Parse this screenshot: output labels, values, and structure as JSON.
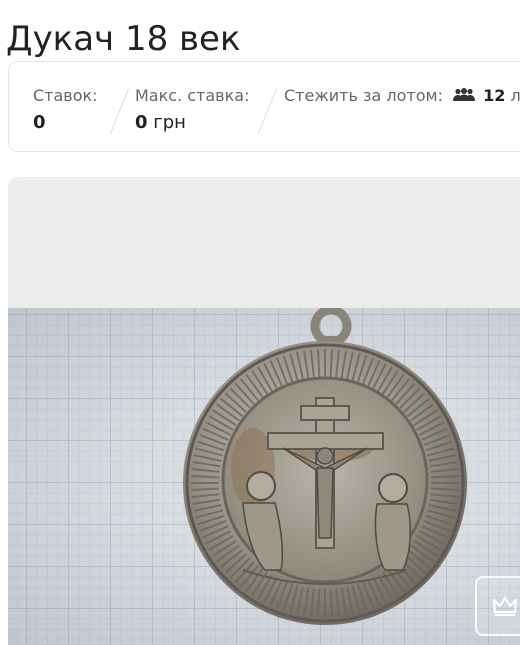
{
  "lot": {
    "title": "Дукач 18 век"
  },
  "stats": {
    "bids_label": "Ставок:",
    "bids_value": "0",
    "max_bid_label": "Макс. ставка:",
    "max_bid_amount": "0",
    "max_bid_currency": "грн",
    "watch_label": "Стежить за лотом:",
    "watch_icon": "people-icon",
    "watch_count": "12",
    "watch_unit": "людей"
  },
  "gallery": {
    "photo_description_icon": "medal-photo",
    "crown_icon": "crown-icon"
  },
  "colors": {
    "text": "#222222",
    "muted": "#666666",
    "border": "#e6e6e6",
    "gallery_bg": "#ececec"
  }
}
